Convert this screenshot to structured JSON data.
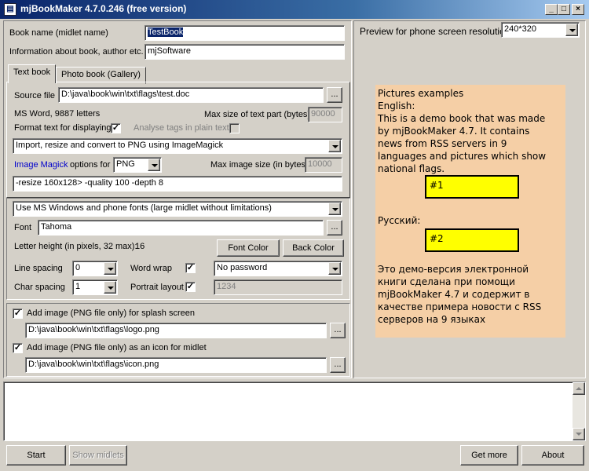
{
  "window": {
    "title": "mjBookMaker 4.7.0.246 (free version)",
    "app_icon": "book-icon"
  },
  "book": {
    "name_label": "Book name (midlet name)",
    "name_value": "TestBook",
    "info_label": "Information about book, author etc.",
    "info_value": "mjSoftware"
  },
  "tabs": [
    "Text book",
    "Photo book (Gallery)"
  ],
  "source": {
    "label": "Source file",
    "path": "D:\\java\\book\\win\\txt\\flags\\test.doc",
    "browse": "...",
    "info": "MS Word, 9887 letters",
    "max_part_label": "Max size of text part (bytes)",
    "max_part_value": "90000",
    "format_label": "Format text for displaying",
    "analyse_label": "Analyse tags in plain text"
  },
  "image": {
    "mode": "Import, resize and convert to PNG using ImageMagick",
    "link": "Image Magick",
    "options_label": "options for",
    "format": "PNG",
    "max_size_label": "Max image size (in bytes)",
    "max_size_value": "10000",
    "args": "-resize 160x128> -quality 100 -depth 8"
  },
  "fonts": {
    "mode": "Use MS Windows and phone fonts (large midlet without limitations)",
    "font_label": "Font",
    "font_value": "Tahoma",
    "browse": "...",
    "height_label": "Letter height (in pixels, 32 max):",
    "height_value": "16",
    "font_color": "Font Color",
    "back_color": "Back Color",
    "line_spacing_label": "Line spacing",
    "line_spacing": "0",
    "word_wrap_label": "Word wrap",
    "password": "No password",
    "char_spacing_label": "Char spacing",
    "char_spacing": "1",
    "portrait_label": "Portrait layout",
    "password_value": "1234"
  },
  "splash": {
    "label": "Add image (PNG file only) for splash screen",
    "path": "D:\\java\\book\\win\\txt\\flags\\logo.png",
    "icon_label": "Add image (PNG file only) as an icon for midlet",
    "icon_path": "D:\\java\\book\\win\\txt\\flags\\icon.png",
    "browse": "..."
  },
  "preview": {
    "label": "Preview  for phone screen resolution:",
    "resolution": "240*320",
    "lines1": [
      "Pictures examples",
      "English:",
      "This is a demo book that was made",
      "by mjBookMaker 4.7. It contains",
      "news from RSS servers in 9",
      "languages and pictures which show",
      "national flags."
    ],
    "box1": "#1",
    "russian": "Русский:",
    "box2": "#2",
    "lines2": [
      "Это демо-версия электронной",
      "книги сделана при помощи",
      "mjBookMaker 4.7 и содержит в",
      "качестве примера новости с RSS",
      "серверов на 9 языках"
    ]
  },
  "bottom": {
    "start": "Start",
    "show_midlets": "Show midlets",
    "get_more": "Get more",
    "about": "About"
  }
}
